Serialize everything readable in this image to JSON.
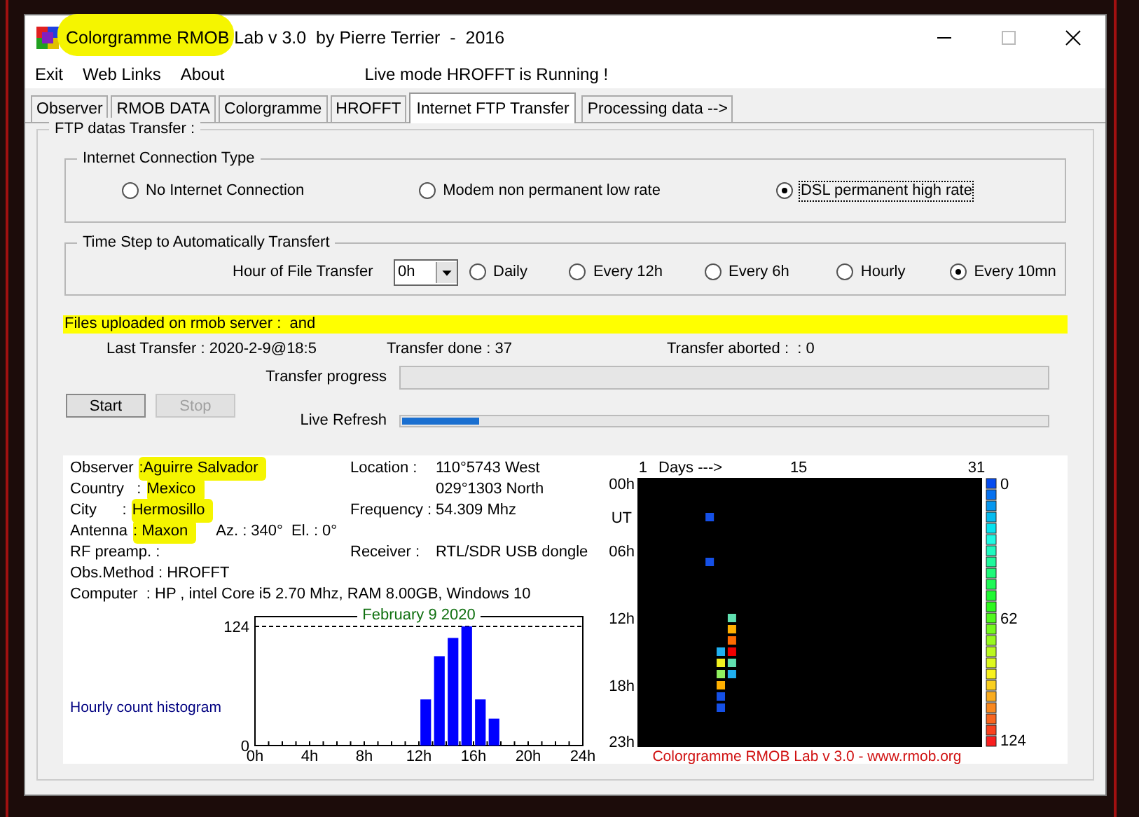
{
  "window": {
    "title": "Colorgramme RMOB Lab v 3.0  by Pierre Terrier  -  2016",
    "title_highlighted": true
  },
  "menu": [
    {
      "label": "Exit"
    },
    {
      "label": "Web Links"
    },
    {
      "label": "About"
    }
  ],
  "live_status": "Live mode HROFFT is Running !",
  "tabs": [
    {
      "label": "Observer",
      "selected": false
    },
    {
      "label": "RMOB DATA",
      "selected": false
    },
    {
      "label": "Colorgramme",
      "selected": false
    },
    {
      "label": "HROFFT",
      "selected": false
    },
    {
      "label": "Internet FTP Transfer",
      "selected": true
    },
    {
      "label": "Processing data -->",
      "selected": false
    }
  ],
  "ftp_group": {
    "title": "FTP datas Transfer :"
  },
  "connection_type": {
    "title": "Internet Connection Type",
    "options": [
      {
        "label": "No Internet Connection",
        "selected": false,
        "focused": false
      },
      {
        "label": "Modem non permanent low rate",
        "selected": false,
        "focused": false
      },
      {
        "label": "DSL permanent high rate",
        "selected": true,
        "focused": true
      }
    ]
  },
  "time_step": {
    "title": "Time Step to Automatically Transfert",
    "hour_label": "Hour of File Transfer",
    "hour_value": "0h",
    "options": [
      {
        "label": "Daily",
        "selected": false
      },
      {
        "label": "Every 12h",
        "selected": false
      },
      {
        "label": "Every 6h",
        "selected": false
      },
      {
        "label": "Hourly",
        "selected": false
      },
      {
        "label": "Every 10mn",
        "selected": true
      }
    ]
  },
  "upload_banner": "Files uploaded on rmob server :  and",
  "last_transfer": "Last Transfer : 2020-2-9@18:5",
  "transfer_done": "Transfer done : 37",
  "transfer_aborted": "Transfer aborted :  : 0",
  "transfer_progress": {
    "label": "Transfer progress",
    "level": 0
  },
  "live_refresh": {
    "label": "Live Refresh",
    "level": 0.12
  },
  "buttons": [
    {
      "label": "Start",
      "disabled": false
    },
    {
      "label": "Stop",
      "disabled": true
    }
  ],
  "info_rows": [
    {
      "label": "Observer",
      "value": ":Aguirre Salvador",
      "highlighted": true,
      "right_label": "Location :",
      "right_value": "110°5743 West"
    },
    {
      "label": "Country   :",
      "value": "Mexico",
      "highlighted": true,
      "right_value": "029°1303 North"
    },
    {
      "label": "City      :",
      "value": "Hermosillo",
      "highlighted": true,
      "right_label": "Frequency :",
      "right_value": "54.309 Mhz"
    },
    {
      "label": "Antenna",
      "value": ": Maxon",
      "highlighted": true,
      "extra": "Az. : 340°  El. : 0°"
    },
    {
      "label": "RF preamp. :",
      "highlighted": false,
      "right_label": "Receiver :",
      "right_value": "RTL/SDR USB dongle"
    },
    {
      "label": "Obs.Method : HROFFT",
      "highlighted": false
    },
    {
      "label": "Computer  : HP , intel Core i5 2.70 Mhz, RAM 8.00GB, Windows 10",
      "highlighted": false
    }
  ],
  "histogram": {
    "label": "Hourly count histogram",
    "chart_data": {
      "type": "bar",
      "title": "February 9 2020",
      "x": [
        0.5,
        1.5,
        2.5,
        3.5,
        4.5,
        5.5,
        6.5,
        7.5,
        8.5,
        9.5,
        10.5,
        11.5,
        12.5,
        13.5,
        14.5,
        15.5,
        16.5,
        17.5,
        18.5,
        19.5,
        20.5,
        21.5,
        22.5,
        23.5
      ],
      "values": [
        0,
        0,
        0,
        0,
        0,
        0,
        0,
        0,
        0,
        0,
        0,
        0,
        48,
        93,
        112,
        124,
        48,
        28,
        0,
        0,
        0,
        0,
        0,
        0
      ],
      "xlim": [
        0,
        24
      ],
      "ylim": [
        0,
        124
      ],
      "yticks": [
        0,
        124
      ],
      "xticks": [
        {
          "value": 0,
          "label": "0h"
        },
        {
          "value": 4,
          "label": "4h"
        },
        {
          "value": 8,
          "label": "8h"
        },
        {
          "value": 12,
          "label": "12h"
        },
        {
          "value": 16,
          "label": "16h"
        },
        {
          "value": 20,
          "label": "20h"
        },
        {
          "value": 24,
          "label": "24h"
        }
      ]
    }
  },
  "colorgramme": {
    "days_caption": "Days --->",
    "ut_caption": "UT",
    "scale_labels": [
      "0",
      "62",
      "124"
    ],
    "chart_data": {
      "type": "scatter",
      "x": [
        7,
        7,
        8,
        8,
        8,
        8,
        8,
        8,
        9,
        9,
        9,
        9,
        9,
        9
      ],
      "series": [
        {
          "color": "#1550e6",
          "values": [
            3,
            7,
            null,
            null,
            null,
            null,
            19,
            20,
            null,
            null,
            null,
            null,
            null,
            null
          ]
        },
        {
          "color": "#20b0f0",
          "values": [
            null,
            null,
            15,
            null,
            null,
            null,
            null,
            null,
            null,
            null,
            null,
            null,
            null,
            17
          ]
        },
        {
          "color": "#f0f020",
          "values": [
            null,
            null,
            null,
            16,
            null,
            null,
            null,
            null,
            null,
            null,
            null,
            null,
            null,
            null
          ]
        },
        {
          "color": "#90f060",
          "values": [
            null,
            null,
            null,
            null,
            17,
            null,
            null,
            null,
            null,
            null,
            null,
            null,
            null,
            null
          ]
        },
        {
          "color": "#ffb000",
          "values": [
            null,
            null,
            null,
            null,
            null,
            18,
            null,
            null,
            null,
            13,
            null,
            null,
            null,
            null
          ]
        },
        {
          "color": "#60e0b0",
          "values": [
            null,
            null,
            null,
            null,
            null,
            null,
            null,
            null,
            12,
            null,
            null,
            null,
            16,
            null
          ]
        },
        {
          "color": "#ff6a00",
          "values": [
            null,
            null,
            null,
            null,
            null,
            null,
            null,
            null,
            null,
            null,
            14,
            null,
            null,
            null
          ]
        },
        {
          "color": "#f00000",
          "values": [
            null,
            null,
            null,
            null,
            null,
            null,
            null,
            null,
            null,
            null,
            null,
            15,
            null,
            null
          ]
        }
      ],
      "xlim": [
        0.5,
        31.5
      ],
      "ylim": [
        23.5,
        -0.5
      ],
      "xticks": [
        1,
        15,
        31
      ],
      "yticks": [
        {
          "value": 0,
          "label": "00h"
        },
        {
          "value": 6,
          "label": "06h"
        },
        {
          "value": 12,
          "label": "12h"
        },
        {
          "value": 18,
          "label": "18h"
        },
        {
          "value": 23,
          "label": "23h"
        }
      ]
    },
    "footer": "Colorgramme RMOB Lab v 3.0 - www.rmob.org"
  }
}
